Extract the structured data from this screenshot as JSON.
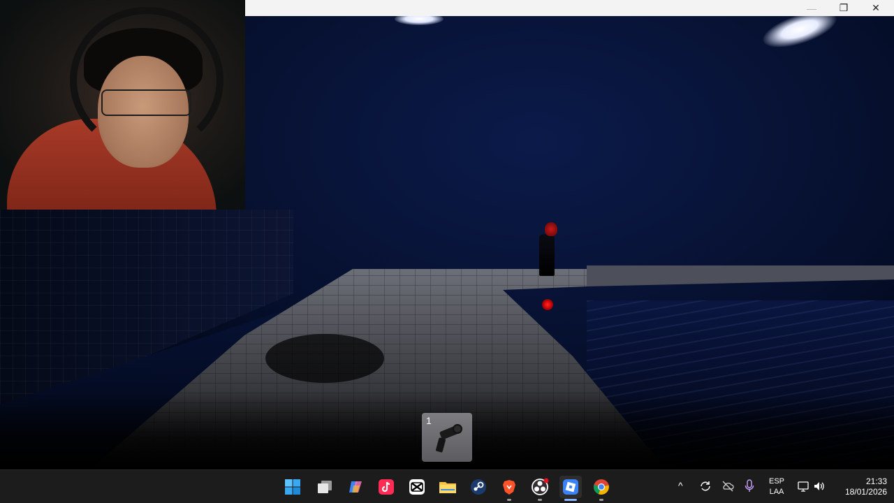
{
  "window": {
    "minimize_glyph": "—",
    "restore_glyph": "❐",
    "close_glyph": "✕"
  },
  "game": {
    "hotbar": [
      {
        "number": "1",
        "item_icon": "flashlight-icon"
      }
    ]
  },
  "taskbar": {
    "icons": [
      "windows-start-icon",
      "task-view-icon",
      "copilot-icon",
      "tiktok-icon",
      "capcut-icon",
      "file-explorer-icon",
      "steam-icon",
      "brave-icon",
      "obs-icon",
      "roblox-icon",
      "chrome-icon"
    ],
    "tray_chevron": "^",
    "language": {
      "line1": "ESP",
      "line2": "LAA"
    },
    "clock": {
      "time": "21:33",
      "date": "18/01/2026"
    }
  },
  "colors": {
    "taskbar_bg": "#1c1c1c",
    "titlebar_bg": "#f3f3f3",
    "accent_red": "#ff2a2a"
  }
}
